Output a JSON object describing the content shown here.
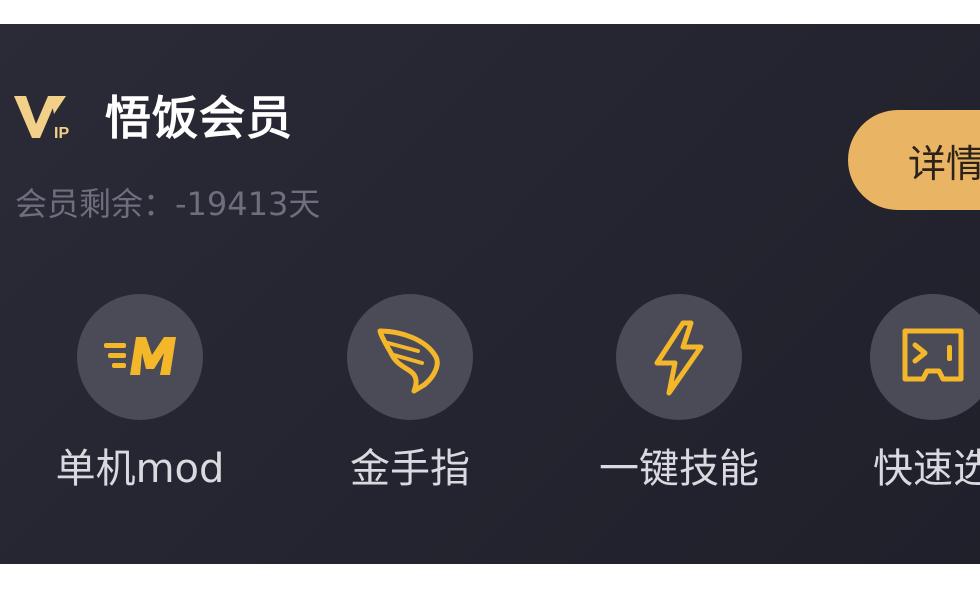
{
  "vip_card": {
    "logo_text": "VIP",
    "title": "悟饭会员",
    "remaining": "会员剩余：-19413天",
    "details_button": "详情",
    "accent_color": "#e9b564",
    "background_color": "#262632"
  },
  "features": [
    {
      "label": "单机mod",
      "icon": "mod-m-icon"
    },
    {
      "label": "金手指",
      "icon": "wing-icon"
    },
    {
      "label": "一键技能",
      "icon": "lightning-icon"
    },
    {
      "label": "快速选",
      "icon": "select-frame-icon"
    }
  ]
}
